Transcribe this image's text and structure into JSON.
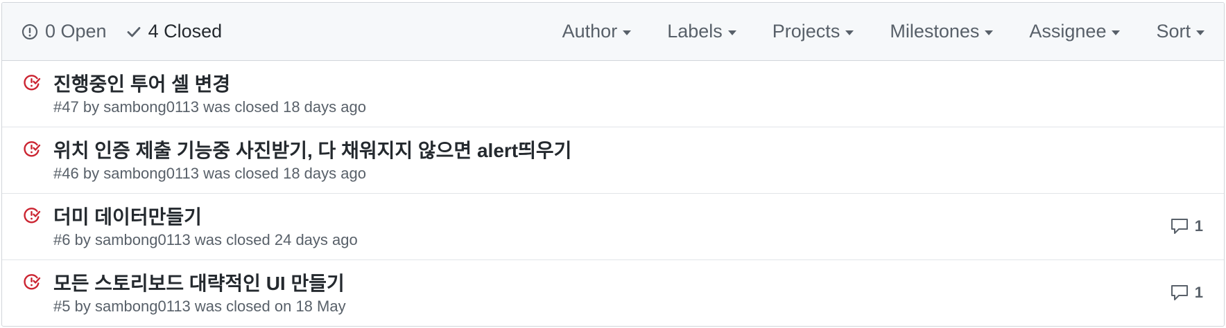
{
  "header": {
    "open_label": "0 Open",
    "closed_label": "4 Closed",
    "filters": [
      "Author",
      "Labels",
      "Projects",
      "Milestones",
      "Assignee",
      "Sort"
    ]
  },
  "issues": [
    {
      "title": "진행중인 투어 셀 변경",
      "number": "#47",
      "by": "by",
      "author": "sambong0113",
      "status_text": "was closed 18 days ago",
      "comments": ""
    },
    {
      "title": "위치 인증 제출 기능중 사진받기, 다 채워지지 않으면 alert띄우기",
      "number": "#46",
      "by": "by",
      "author": "sambong0113",
      "status_text": "was closed 18 days ago",
      "comments": ""
    },
    {
      "title": "더미 데이터만들기",
      "number": "#6",
      "by": "by",
      "author": "sambong0113",
      "status_text": "was closed 24 days ago",
      "comments": "1"
    },
    {
      "title": "모든 스토리보드 대략적인 UI 만들기",
      "number": "#5",
      "by": "by",
      "author": "sambong0113",
      "status_text": "was closed on 18 May",
      "comments": "1"
    }
  ],
  "colors": {
    "closed_icon": "#cb2431",
    "muted_text": "#586069",
    "title_text": "#24292e",
    "header_bg": "#f6f8fa",
    "border": "#d1d5da"
  }
}
